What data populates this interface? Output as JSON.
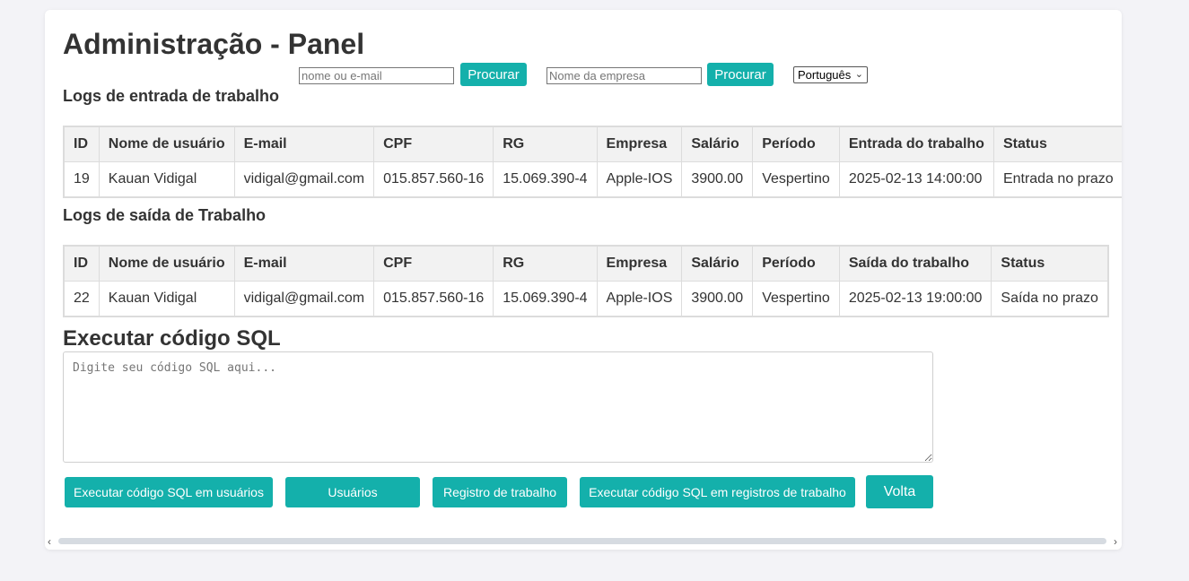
{
  "header": {
    "title": "Administração - Panel"
  },
  "search": {
    "user_placeholder": "nome ou e-mail",
    "user_button": "Procurar",
    "company_placeholder": "Nome da empresa",
    "company_button": "Procurar",
    "language": "Português"
  },
  "entry_logs": {
    "title": "Logs de entrada de trabalho",
    "headers": [
      "ID",
      "Nome de usuário",
      "E-mail",
      "CPF",
      "RG",
      "Empresa",
      "Salário",
      "Período",
      "Entrada do trabalho",
      "Status"
    ],
    "rows": [
      [
        "19",
        "Kauan Vidigal",
        "vidigal@gmail.com",
        "015.857.560-16",
        "15.069.390-4",
        "Apple-IOS",
        "3900.00",
        "Vespertino",
        "2025-02-13 14:00:00",
        "Entrada no prazo"
      ]
    ]
  },
  "exit_logs": {
    "title": "Logs de saída de Trabalho",
    "headers": [
      "ID",
      "Nome de usuário",
      "E-mail",
      "CPF",
      "RG",
      "Empresa",
      "Salário",
      "Período",
      "Saída do trabalho",
      "Status"
    ],
    "rows": [
      [
        "22",
        "Kauan Vidigal",
        "vidigal@gmail.com",
        "015.857.560-16",
        "15.069.390-4",
        "Apple-IOS",
        "3900.00",
        "Vespertino",
        "2025-02-13 19:00:00",
        "Saída no prazo"
      ]
    ]
  },
  "sql": {
    "title": "Executar código SQL",
    "placeholder": "Digite seu código SQL aqui..."
  },
  "actions": {
    "run_users": "Executar código SQL em usuários",
    "users": "Usuários",
    "work_log": "Registro de trabalho",
    "run_work_logs": "Executar código SQL em registros de trabalho",
    "back": "Volta"
  },
  "colors": {
    "accent": "#14b0ab",
    "header_bg": "#f2f2f2",
    "page_bg": "#f3f3f7"
  },
  "icons": {
    "select_chevron": "chevron-down-icon",
    "scroll_left": "chevron-left-icon",
    "scroll_right": "chevron-right-icon"
  }
}
